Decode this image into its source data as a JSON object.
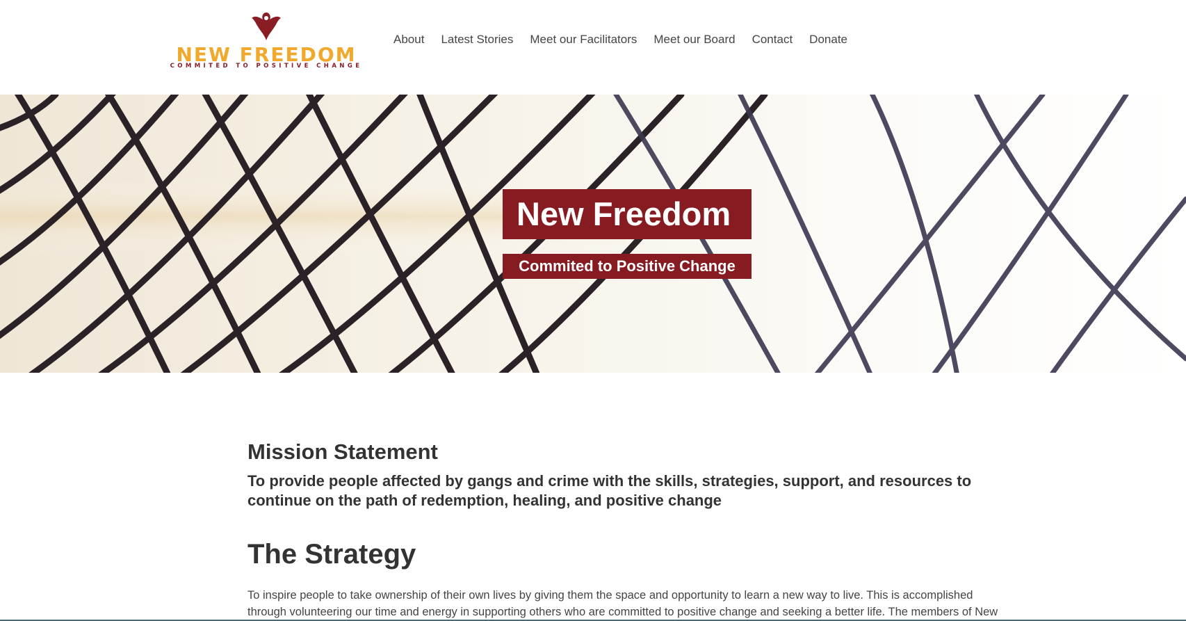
{
  "logo": {
    "wordmark": "NEW FREEDOM",
    "tagline": "COMMITED TO POSITIVE CHANGE",
    "emblem_icon": "bird-emblem-icon"
  },
  "nav": {
    "items": [
      {
        "label": "About"
      },
      {
        "label": "Latest Stories"
      },
      {
        "label": "Meet our Facilitators"
      },
      {
        "label": "Meet our Board"
      },
      {
        "label": "Contact"
      },
      {
        "label": "Donate"
      }
    ]
  },
  "hero": {
    "title": "New Freedom",
    "subtitle": "Commited to Positive Change"
  },
  "mission": {
    "heading": "Mission Statement",
    "text": "To provide people affected by gangs and crime with the skills, strategies, support, and resources to continue on the path of redemption, healing, and positive change"
  },
  "strategy": {
    "heading": "The Strategy",
    "text": "To inspire people to take ownership of their own lives by giving them the space and opportunity to learn a new way to live. This is accomplished through volunteering our time and energy in supporting others who are committed to positive change and seeking a better life. The members of New"
  },
  "colors": {
    "brand_red": "#861b21",
    "logo_gold": "#f0a92c",
    "text": "#333333"
  }
}
